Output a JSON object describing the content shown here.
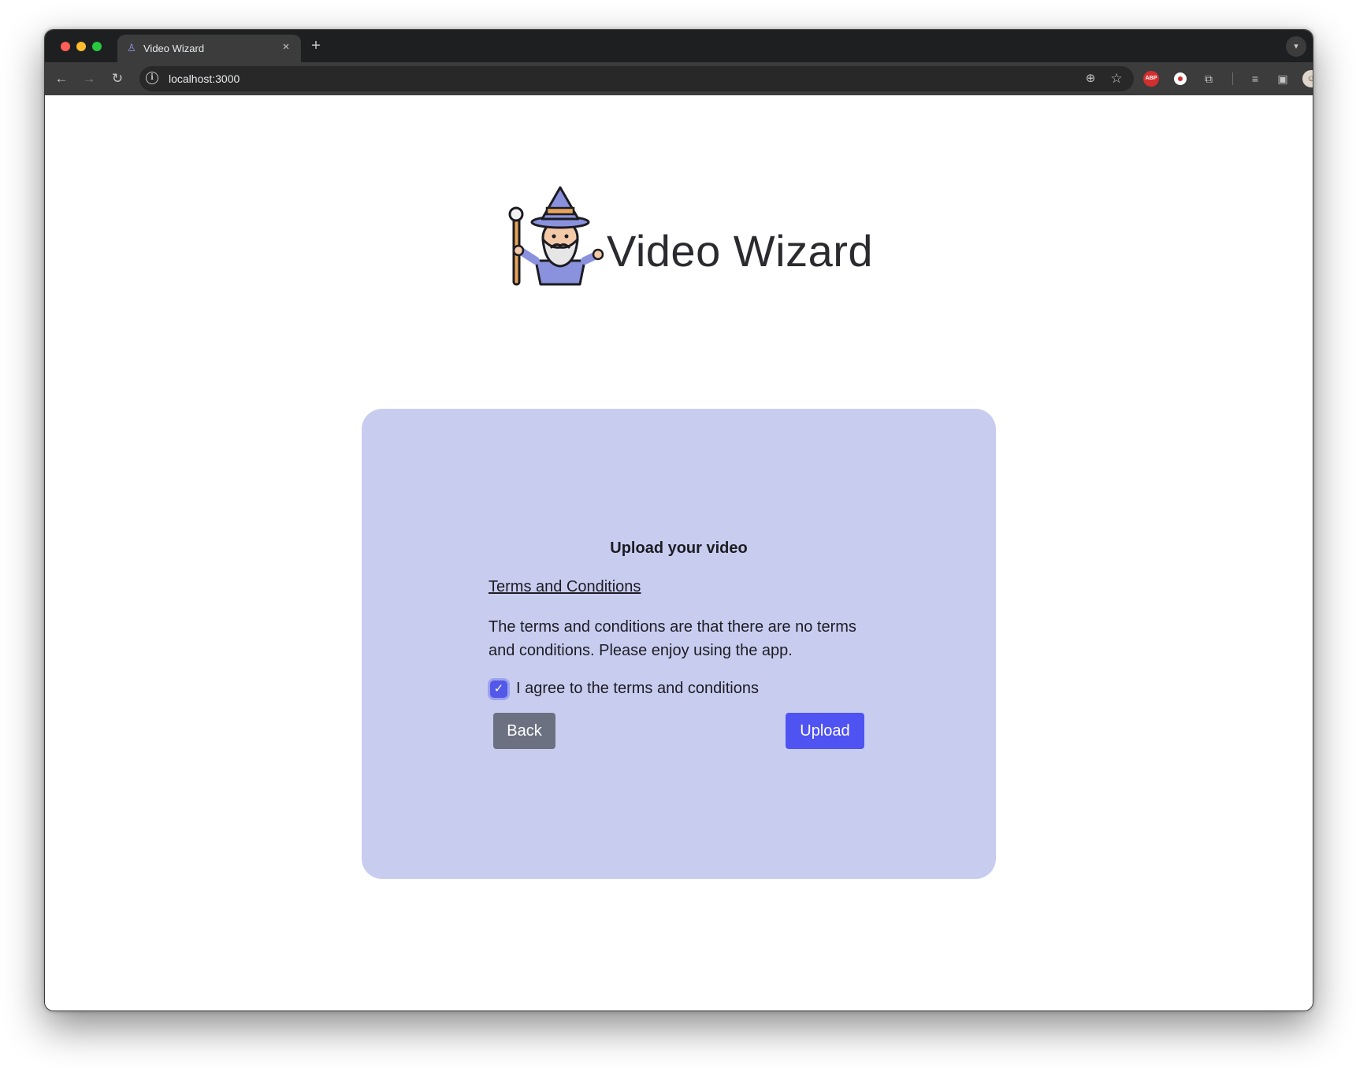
{
  "browser": {
    "tab_title": "Video Wizard",
    "tab_close": "×",
    "new_tab": "+",
    "url": "localhost:3000",
    "abp_label": "ABP",
    "icons": [
      "back-arrow-icon",
      "forward-arrow-icon",
      "reload-icon",
      "site-info-icon",
      "zoom-icon",
      "star-icon",
      "adblock-plus-icon",
      "record-icon",
      "extensions-puzzle-icon",
      "media-control-icon",
      "side-panel-icon",
      "profile-avatar-icon",
      "more-menu-icon"
    ]
  },
  "header": {
    "title": "Video Wizard"
  },
  "card": {
    "heading": "Upload your video",
    "terms_link": "Terms and Conditions",
    "terms_text": "The terms and conditions are that there are no terms and conditions. Please enjoy using the app.",
    "agree_label": "I agree to the terms and conditions",
    "agree_checked": true,
    "back_label": "Back",
    "upload_label": "Upload"
  },
  "colors": {
    "card_bg": "#c8cdf0",
    "primary": "#4f53f2",
    "secondary": "#6b7180",
    "checkbox": "#5258e8"
  }
}
